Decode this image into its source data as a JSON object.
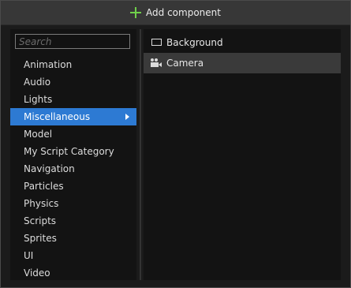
{
  "header": {
    "title": "Add component",
    "icon": "plus-icon",
    "icon_color": "#6fcf4a"
  },
  "search": {
    "placeholder": "Search",
    "value": ""
  },
  "categories": {
    "items": [
      {
        "label": "Animation"
      },
      {
        "label": "Audio"
      },
      {
        "label": "Lights"
      },
      {
        "label": "Miscellaneous"
      },
      {
        "label": "Model"
      },
      {
        "label": "My Script Category"
      },
      {
        "label": "Navigation"
      },
      {
        "label": "Particles"
      },
      {
        "label": "Physics"
      },
      {
        "label": "Scripts"
      },
      {
        "label": "Sprites"
      },
      {
        "label": "UI"
      },
      {
        "label": "Video"
      }
    ],
    "selected_label": "Miscellaneous",
    "selected_color": "#2d7ad3"
  },
  "components": {
    "items": [
      {
        "label": "Background",
        "icon": "background-icon"
      },
      {
        "label": "Camera",
        "icon": "camera-icon"
      }
    ],
    "selected_label": "Camera"
  }
}
